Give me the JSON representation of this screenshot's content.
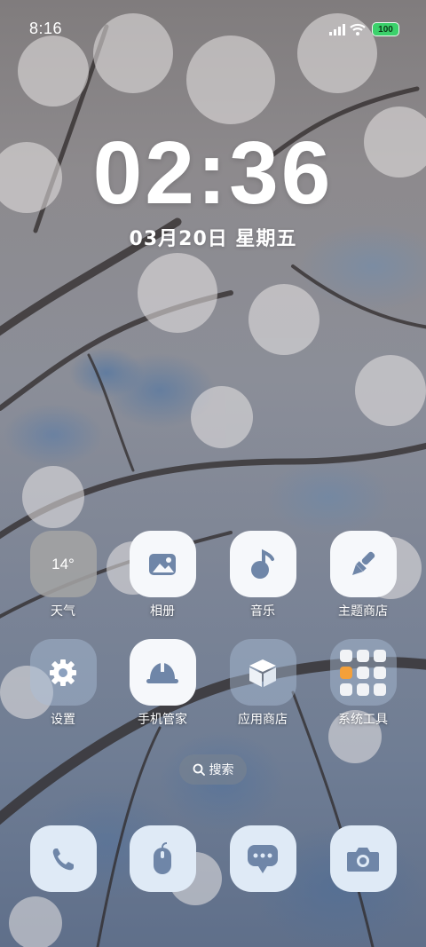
{
  "status_bar": {
    "time": "8:16",
    "battery": "100"
  },
  "lockclock": {
    "time": "02:36",
    "date": "03月20日 星期五"
  },
  "weather_widget": {
    "temp": "14°"
  },
  "apps_row1": [
    {
      "label": "天气",
      "icon": "weather-icon"
    },
    {
      "label": "相册",
      "icon": "gallery-icon"
    },
    {
      "label": "音乐",
      "icon": "music-icon"
    },
    {
      "label": "主题商店",
      "icon": "brush-icon"
    }
  ],
  "apps_row2": [
    {
      "label": "设置",
      "icon": "gear-icon"
    },
    {
      "label": "手机管家",
      "icon": "helmet-icon"
    },
    {
      "label": "应用商店",
      "icon": "box-icon"
    },
    {
      "label": "系统工具",
      "icon": "folder-icon"
    }
  ],
  "search": {
    "label": "搜索"
  },
  "dock": [
    {
      "icon": "phone-icon"
    },
    {
      "icon": "browser-icon"
    },
    {
      "icon": "message-icon"
    },
    {
      "icon": "camera-icon"
    }
  ],
  "colors": {
    "icon_glyph": "#6f86a8",
    "battery": "#3bd16b"
  }
}
